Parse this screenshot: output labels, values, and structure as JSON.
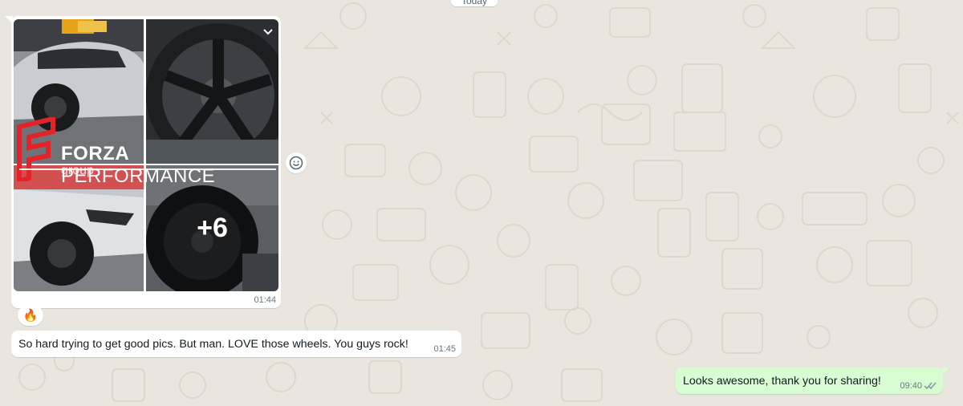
{
  "date_chip": "Today",
  "album": {
    "more_count": "+6",
    "time": "01:44",
    "watermark": {
      "brand_bold": "FORZA",
      "brand_rest": " PERFORMANCE",
      "sub": "group"
    }
  },
  "reaction": {
    "emoji": "🔥"
  },
  "incoming_message": {
    "text": "So hard trying to get good pics. But man. LOVE those wheels. You guys rock!",
    "time": "01:45"
  },
  "outgoing_message": {
    "text": "Looks awesome, thank you for sharing!",
    "time": "09:40",
    "status": "read"
  },
  "colors": {
    "chat_background": "#eae6df",
    "incoming_bubble": "#ffffff",
    "outgoing_bubble": "#d9fdd3",
    "read_tick": "#53bdeb",
    "brand_red": "#e4222a"
  },
  "icons": {
    "chevron": "chevron-down-icon",
    "react": "smiley-icon",
    "ticks": "double-check-icon"
  }
}
